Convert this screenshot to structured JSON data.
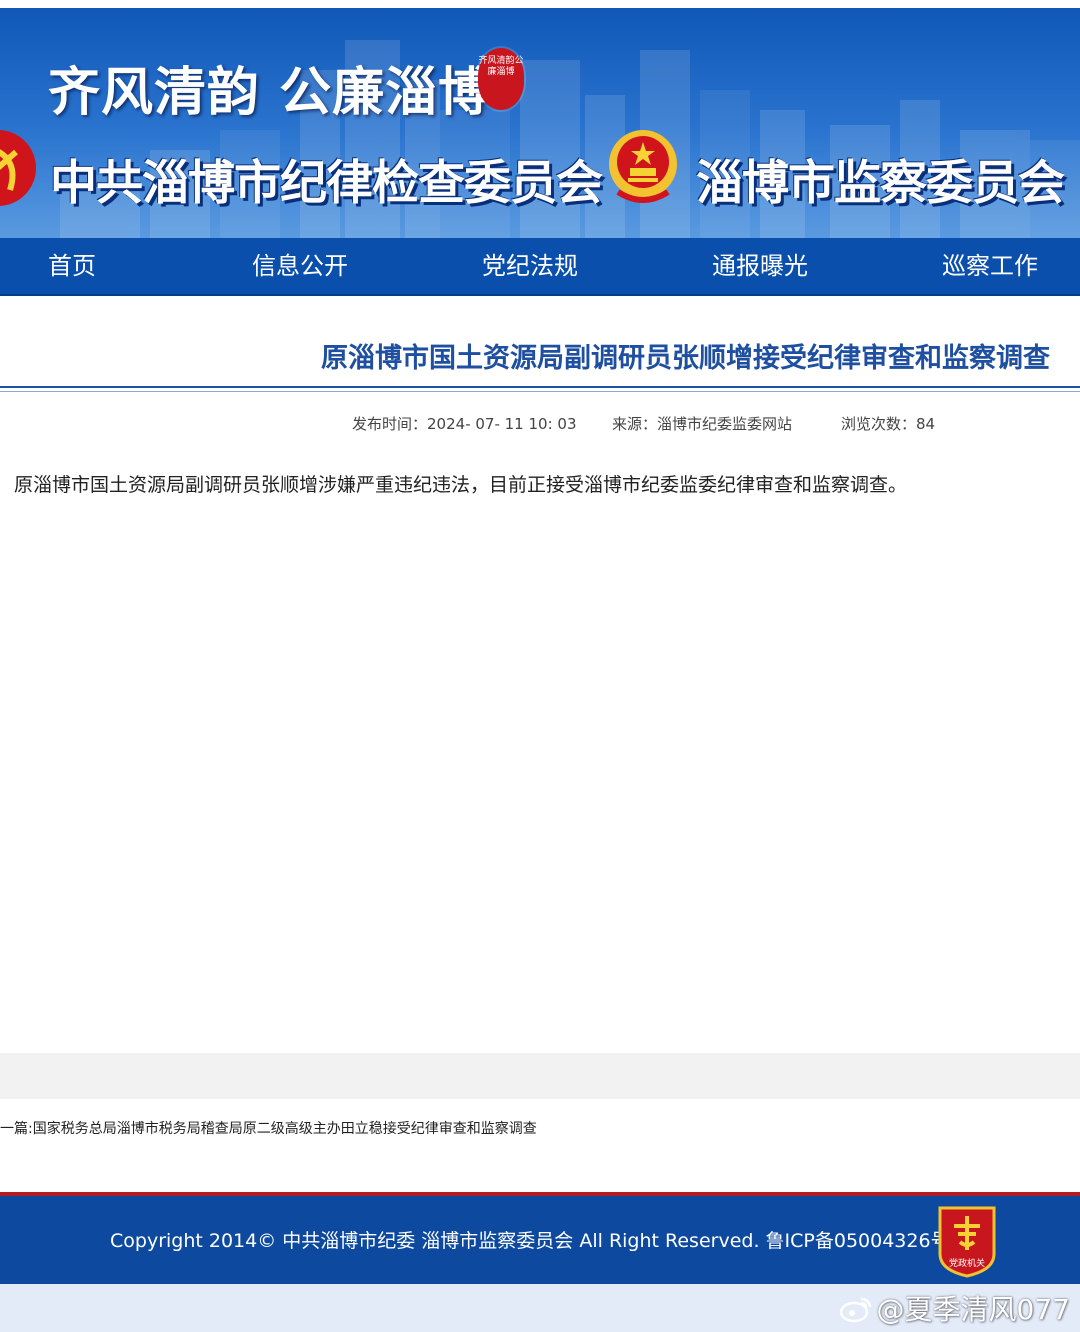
{
  "banner": {
    "slogan": "齐风清韵 公廉淄博",
    "seal_text": "齐风清韵公廉淄博",
    "commission_name": "中共淄博市纪律检查委员会",
    "supervision_name": "淄博市监察委员会"
  },
  "nav": {
    "items": [
      {
        "label": "首页"
      },
      {
        "label": "信息公开"
      },
      {
        "label": "党纪法规"
      },
      {
        "label": "通报曝光"
      },
      {
        "label": "巡察工作"
      }
    ]
  },
  "article": {
    "title": "原淄博市国土资源局副调研员张顺增接受纪律审查和监察调查",
    "publish_time_label": "发布时间：",
    "publish_time": "2024- 07- 11 10: 03",
    "source_label": "来源：",
    "source": "淄博市纪委监委网站",
    "views_label": "浏览次数：",
    "views": "84",
    "body": "原淄博市国土资源局副调研员张顺增涉嫌严重违纪违法，目前正接受淄博市纪委监委纪律审查和监察调查。"
  },
  "prev_article": {
    "label": "一篇:",
    "title": "国家税务总局淄博市税务局稽查局原二级高级主办田立稳接受纪律审查和监察调查"
  },
  "footer": {
    "copyright": "Copyright 2014© 中共淄博市纪委 淄博市监察委员会 All Right Reserved. 鲁ICP备05004326号",
    "badge_text": "党政机关"
  },
  "watermark": {
    "text": "@夏季清风077"
  },
  "colors": {
    "nav_blue": "#0b4fad",
    "title_blue": "#1e4fa0",
    "footer_blue": "#0d4a9f",
    "footer_red_line": "#b01e24",
    "seal_red": "#c9151e"
  }
}
